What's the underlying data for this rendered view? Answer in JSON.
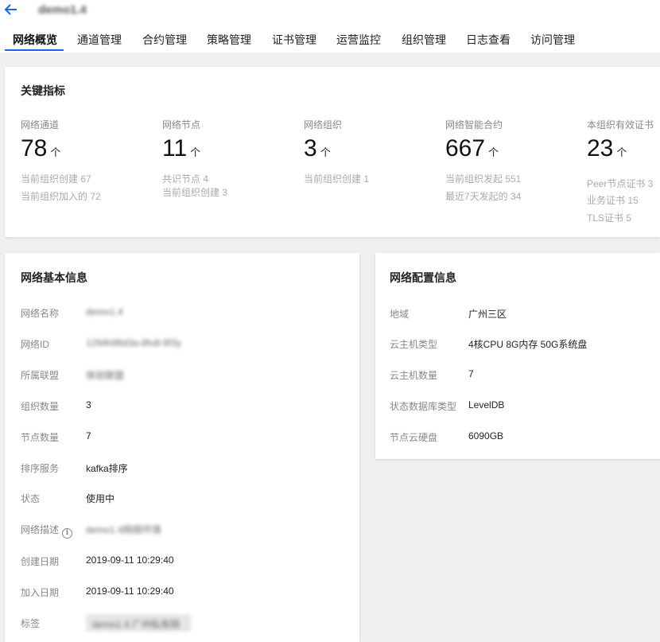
{
  "header": {
    "title": "demo1.4",
    "tabs": [
      "网络概览",
      "通道管理",
      "合约管理",
      "策略管理",
      "证书管理",
      "运营监控",
      "组织管理",
      "日志查看",
      "访问管理"
    ]
  },
  "key_metrics": {
    "title": "关键指标",
    "unit": "个",
    "items": [
      {
        "label": "网络通道",
        "value": "78",
        "subs": [
          "当前组织创建 67",
          "当前组织加入的 72"
        ]
      },
      {
        "label": "网络节点",
        "value": "11",
        "subs": [
          "共识节点 4",
          "当前组织创建 3"
        ]
      },
      {
        "label": "网络组织",
        "value": "3",
        "subs": [
          "当前组织创建 1"
        ]
      },
      {
        "label": "网络智能合约",
        "value": "667",
        "subs": [
          "当前组织发起 551",
          "最近7天发起的 34"
        ]
      },
      {
        "label": "本组织有效证书",
        "value": "23",
        "subs": [
          "Peer节点证书 3",
          "业务证书 15",
          "TLS证书 5"
        ]
      }
    ]
  },
  "basic_info": {
    "title": "网络基本信息",
    "rows": [
      {
        "label": "网络名称",
        "value": "demo1.4"
      },
      {
        "label": "网络ID",
        "value": "1294h9fid3a-8fu8-8f3y"
      },
      {
        "label": "所属联盟",
        "value": "体验联盟"
      },
      {
        "label": "组织数量",
        "value": "3"
      },
      {
        "label": "节点数量",
        "value": "7"
      },
      {
        "label": "排序服务",
        "value": "kafka排序"
      },
      {
        "label": "状态",
        "value": "使用中"
      },
      {
        "label": "网络描述",
        "value": "demo1.4网络环境"
      },
      {
        "label": "创建日期",
        "value": "2019-09-11 10:29:40"
      },
      {
        "label": "加入日期",
        "value": "2019-09-11 10:29:40"
      },
      {
        "label": "标签",
        "value": "demo1.4 广州私有网"
      }
    ]
  },
  "config_info": {
    "title": "网络配置信息",
    "rows": [
      {
        "label": "地域",
        "value": "广州三区"
      },
      {
        "label": "云主机类型",
        "value": "4核CPU 8G内存 50G系统盘"
      },
      {
        "label": "云主机数量",
        "value": "7"
      },
      {
        "label": "状态数据库类型",
        "value": "LevelDB"
      },
      {
        "label": "节点云硬盘",
        "value": "6090GB"
      }
    ]
  },
  "colors": {
    "accent": "#1664ff",
    "background": "#f0f0f0"
  }
}
